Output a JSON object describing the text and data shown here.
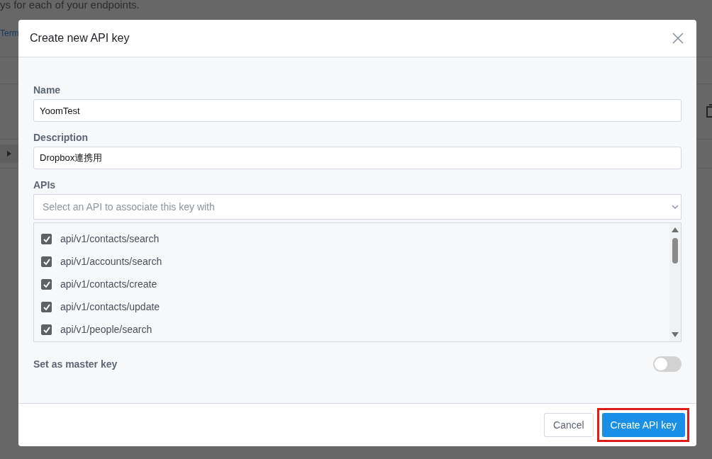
{
  "background": {
    "text": "ys for each of your endpoints.",
    "link": "Term"
  },
  "dialog": {
    "title": "Create new API key",
    "fields": [
      {
        "label": "Name",
        "value": "YoomTest"
      },
      {
        "label": "Description",
        "value": "Dropbox連携用"
      }
    ],
    "apis": {
      "label": "APIs",
      "placeholder": "Select an API to associate this key with",
      "items": [
        {
          "name": "api/v1/contacts/search",
          "checked": true
        },
        {
          "name": "api/v1/accounts/search",
          "checked": true
        },
        {
          "name": "api/v1/contacts/create",
          "checked": true
        },
        {
          "name": "api/v1/contacts/update",
          "checked": true
        },
        {
          "name": "api/v1/people/search",
          "checked": true
        }
      ]
    },
    "master_key": {
      "label": "Set as master key",
      "on": false
    },
    "buttons": [
      {
        "label": "Cancel",
        "kind": "secondary",
        "highlighted": false
      },
      {
        "label": "Create API key",
        "kind": "primary",
        "highlighted": true
      }
    ]
  }
}
